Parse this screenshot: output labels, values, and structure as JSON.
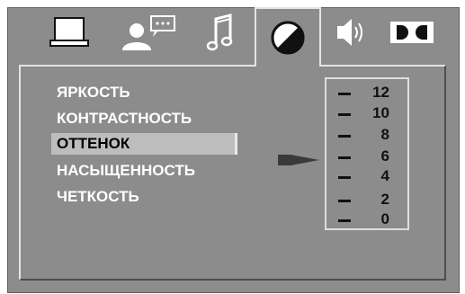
{
  "tabs": [
    {
      "icon": "monitor-icon",
      "active": false
    },
    {
      "icon": "user-speech-icon",
      "active": false
    },
    {
      "icon": "music-note-icon",
      "active": false
    },
    {
      "icon": "contrast-circle-icon",
      "active": true
    },
    {
      "icon": "speaker-icon",
      "active": false
    },
    {
      "icon": "dolby-icon",
      "active": false
    }
  ],
  "menu": {
    "items": [
      {
        "label": "ЯРКОСТЬ",
        "selected": false
      },
      {
        "label": "КОНТРАСТНОСТЬ",
        "selected": false
      },
      {
        "label": "ОТТЕНОК",
        "selected": true
      },
      {
        "label": "НАСЫЩЕННОСТЬ",
        "selected": false
      },
      {
        "label": "ЧЕТКОСТЬ",
        "selected": false
      }
    ]
  },
  "scale": {
    "values": [
      "12",
      "10",
      "8",
      "6",
      "4",
      "2",
      "0"
    ],
    "current": "6"
  },
  "colors": {
    "frame": "#8c8c8c",
    "highlight": "#bdbdbd",
    "text": "#ffffff"
  }
}
